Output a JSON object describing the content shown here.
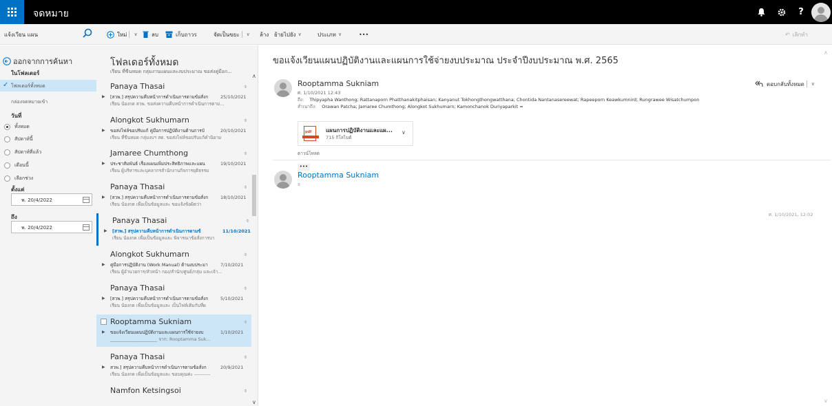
{
  "app": {
    "title": "จดหมาย"
  },
  "topbar": {
    "help_label": "?"
  },
  "toolbar": {
    "search_text": "แจ้งเวียน แผน",
    "new_label": "ใหม่",
    "delete_label": "ลบ",
    "archive_label": "เก็บถาวร",
    "organize_label": "จัดเป็นขยะ",
    "clear_label": "ล้าง",
    "move_label": "ย้ายไปยัง",
    "category_label": "ประเภท",
    "more_label": "•••",
    "undo_label": "เลิกทำ"
  },
  "leftnav": {
    "back_label": "ออกจากการค้นหา",
    "in_folder_label": "ในโฟลเดอร์",
    "all_folders_label": "โฟลเดอร์ทั้งหมด",
    "trash_label": "กล่องจดหมายเข้า",
    "date_label": "วันที่",
    "radios": [
      {
        "label": "ทั้งหมด",
        "selected": true
      },
      {
        "label": "สัปดาห์นี้",
        "selected": false
      },
      {
        "label": "สัปดาห์ที่แล้ว",
        "selected": false
      },
      {
        "label": "เดือนนี้",
        "selected": false
      },
      {
        "label": "เลือกช่วง",
        "selected": false
      }
    ],
    "from_label": "ตั้งแต่",
    "from_value": "พ. 20/4/2022",
    "to_label": "ถึง",
    "to_value": "พ. 20/4/2022"
  },
  "list": {
    "title": "โฟลเดอร์ทั้งหมด",
    "subtitle": "เรียน ที่ขีนหมด กลุ่มงานแผนและงบประมาณ ขอส่งคู่มือก...",
    "messages": [
      {
        "sender": "Panaya Thasai",
        "subject": "[สวพ.] สรุปความคืบหน้าการดำเนินการตามข้อสั่งก",
        "date": "25/10/2021",
        "preview": "เรียน น้องกด สวพ. ขอส่งความคืบหน้าการดำเนินการตาม..."
      },
      {
        "sender": "Alongkot Sukhumarn",
        "subject": "ขอส่งไฟล์ขอปรับแก้ คู่มือการปฏิบัติงานด้านการบั",
        "date": "20/10/2021",
        "preview": "เรียน ที่ขีนหมด กลุ่มงบฯ สด. ขอส่งไฟล์ขอปรับแก้คำนิยาม"
      },
      {
        "sender": "Jamaree Chumthong",
        "subject": "ประชาสัมพันธ์ เรื่องแผนเพิ่มประสิทธิภาพและแผน",
        "date": "19/10/2021",
        "preview": "เรียน ผู้บริหารและบุคลากรสำนักงานกิจการยุติธรรม"
      },
      {
        "sender": "Panaya Thasai",
        "subject": "[สวพ.] สรุปความคืบหน้าการดำเนินการตามข้อสั่งก",
        "date": "18/10/2021",
        "preview": "เรียน น้องกด เพื่อเป็นข้อมูลและ ขอแจ้งข้อผิดว่า"
      },
      {
        "sender": "Panaya Thasai",
        "subject": "[สวพ.] สรุปความคืบหน้าการดำเนินการตามข้",
        "date": "11/10/2021",
        "preview": "เรียน น้องกด เพื่อเป็นข้อมูลและ พิจารณาข้อสั่งการบา"
      },
      {
        "sender": "Alongkot Sukhumarn",
        "subject": "คู่มือการปฏิบัติงาน (Work Manual) ด้านงบประมา",
        "date": "7/10/2021",
        "preview": "เรียน ผู้อำนวยการ/หัวหน้า กอง/สำนัก/ศูนย์/กลุ่ม และเจ้า..."
      },
      {
        "sender": "Panaya Thasai",
        "subject": "[สวพ.] สรุปความคืบหน้าการดำเนินการตามข้อสั่งก",
        "date": "5/10/2021",
        "preview": "เรียน น้องกด เพื่อเป็นข้อมูลและ เป็นไฟล์เดิมกับที่ผ"
      },
      {
        "sender": "Rooptamma Sukniam",
        "subject": "ขอแจ้งเวียนแผนปฏิบัติงานและแผนการใช้จ่ายงบ",
        "date": "1/10/2021",
        "preview": "_____________________ จาก: Rooptamma Suk..."
      },
      {
        "sender": "Panaya Thasai",
        "subject": "สวพ.] สรุปความคืบหน้าการดำเนินการตามข้อสั่งก",
        "date": "20/9/2021",
        "preview": "เรียน น้องกด เพื่อเป็นข้อมูลและ ขอบคุณค่ะ ----------"
      },
      {
        "sender": "Namfon Ketsingsoi",
        "subject": "",
        "date": "",
        "preview": ""
      }
    ]
  },
  "reading": {
    "subject": "ขอแจ้งเวียนแผนปฏิบัติงานและแผนการใช้จ่ายงบประมาณ ประจำปีงบประมาณ พ.ศ. 2565",
    "sender": "Rooptamma Sukniam",
    "time": "ศ. 1/10/2021 12:43",
    "to_label": "ถึง:",
    "to": "Thipyapha Wanthong; Rattanaporn Phatthanakitphaisan; Kanyanut Tokhongthongwatthana; Chontida Nantanasereewat; Rapeeporn Keawkumnird; Rungrawee Wisatchumpon",
    "cc_label": "สำเนาถึง:",
    "cc": "Orawan Patcha; Jamaree Chumthong; Alongkot Sukhumarn; Kamonchanok Duriyaparkit ≈",
    "reply_all_label": "ตอบกลับทั้งหมด",
    "attachment_name": "แผนการปฏิบัติงานและแผ...",
    "attachment_size": "715 กิโลไบต์",
    "download_label": "ดาวน์โหลด",
    "more_label": "•••",
    "second_sender": "Rooptamma Sukniam",
    "second_meta": "ฮ",
    "second_date": "ศ. 1/10/2021, 12:02"
  }
}
